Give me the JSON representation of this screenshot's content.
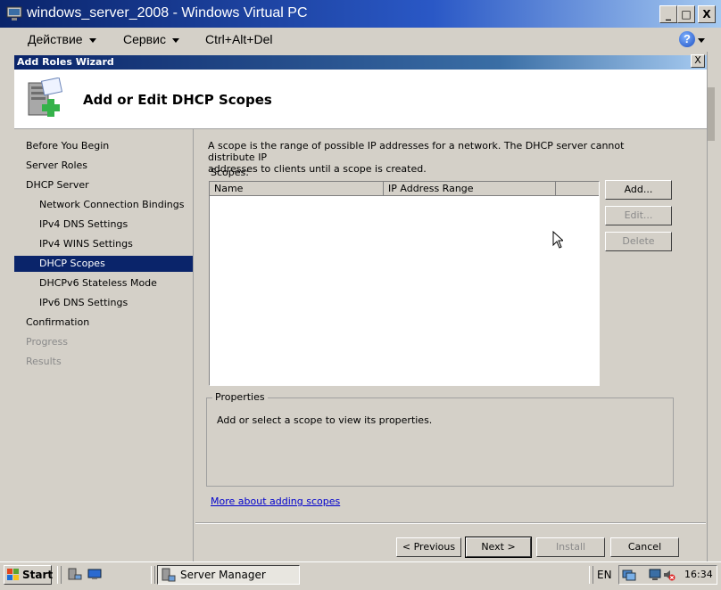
{
  "window": {
    "title": "windows_server_2008 - Windows Virtual PC",
    "minimize_glyph": "_",
    "maximize_glyph": "□",
    "close_glyph": "X"
  },
  "menubar": {
    "items": [
      "Действие",
      "Сервис",
      "Ctrl+Alt+Del"
    ],
    "help_glyph": "?"
  },
  "wizard": {
    "title": "Add Roles Wizard",
    "close_glyph": "X",
    "header": "Add or Edit DHCP Scopes",
    "nav": [
      {
        "label": "Before You Begin",
        "state": "normal"
      },
      {
        "label": "Server Roles",
        "state": "normal"
      },
      {
        "label": "DHCP Server",
        "state": "normal"
      },
      {
        "label": "Network Connection Bindings",
        "state": "sub"
      },
      {
        "label": "IPv4 DNS Settings",
        "state": "sub"
      },
      {
        "label": "IPv4 WINS Settings",
        "state": "sub"
      },
      {
        "label": "DHCP Scopes",
        "state": "selected"
      },
      {
        "label": "DHCPv6 Stateless Mode",
        "state": "sub"
      },
      {
        "label": "IPv6 DNS Settings",
        "state": "sub"
      },
      {
        "label": "Confirmation",
        "state": "normal"
      },
      {
        "label": "Progress",
        "state": "disabled"
      },
      {
        "label": "Results",
        "state": "disabled"
      }
    ],
    "description_line1": "A scope is the range of possible IP addresses for a network. The DHCP server cannot distribute IP",
    "description_line2": "addresses to clients until a scope is created.",
    "scopes_label": "Scopes:",
    "columns": [
      "Name",
      "IP Address Range"
    ],
    "buttons": {
      "add": "Add...",
      "edit": "Edit...",
      "delete": "Delete",
      "previous": "< Previous",
      "next": "Next >",
      "install": "Install",
      "cancel": "Cancel"
    },
    "properties_legend": "Properties",
    "properties_text": "Add or select a scope to view its properties.",
    "more_link": "More about adding scopes"
  },
  "taskbar": {
    "start": "Start",
    "task": "Server Manager",
    "language": "EN",
    "clock": "16:34"
  },
  "colors": {
    "title_blue": "#0a246a",
    "selected_bg": "#0a246a",
    "face": "#d4d0c8",
    "link": "#0000cc"
  }
}
